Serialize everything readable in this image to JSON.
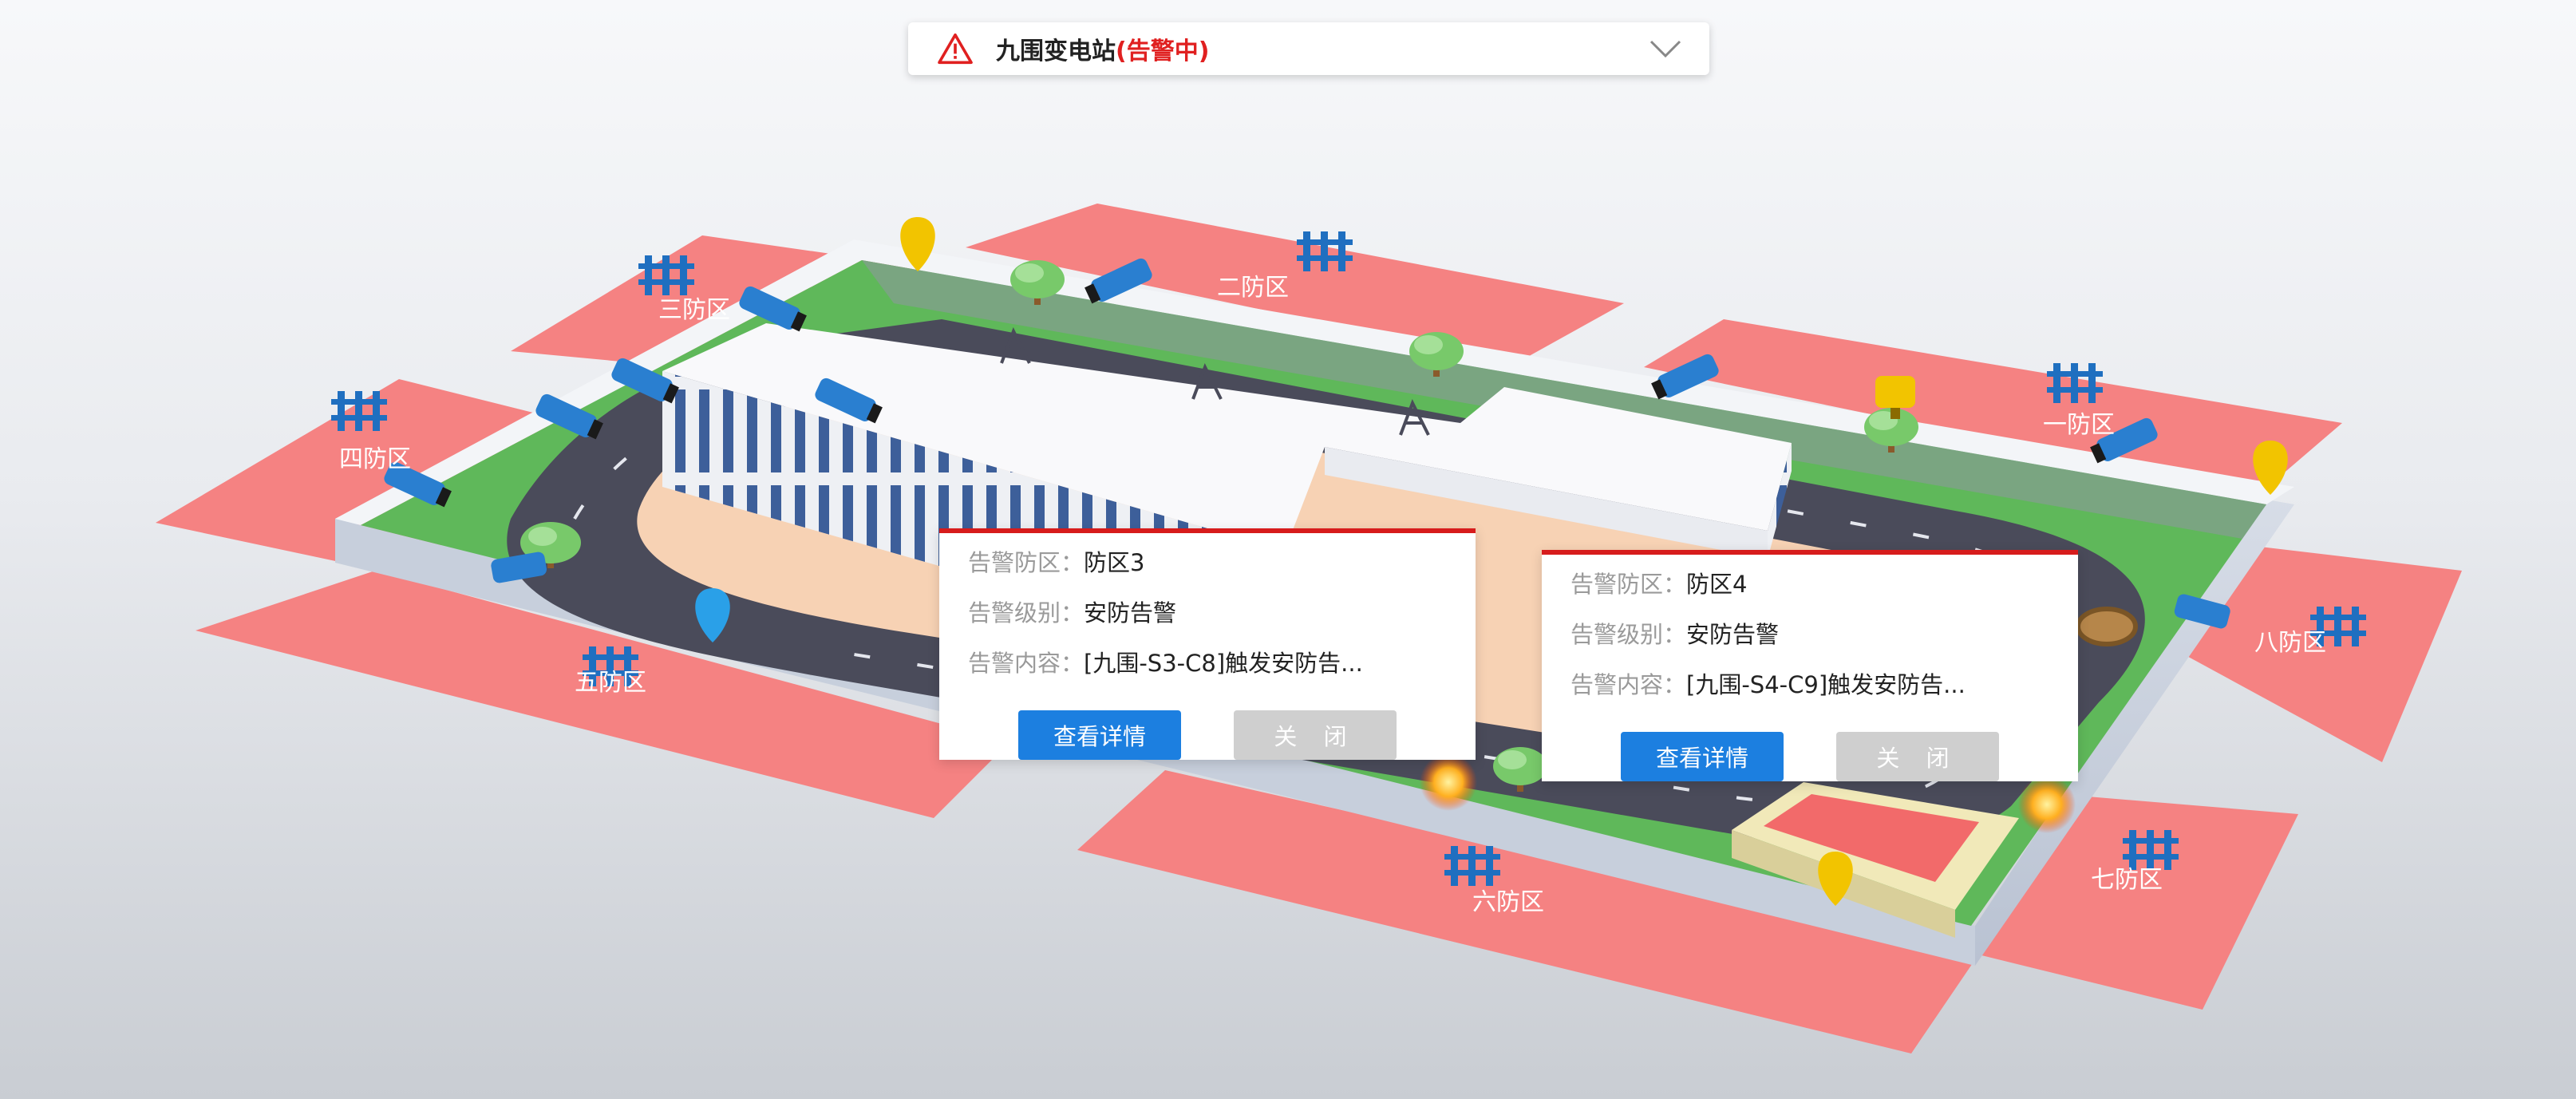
{
  "station": {
    "name": "九围变电站",
    "status": "(告警中)",
    "status_color": "#e02020"
  },
  "zones": [
    {
      "id": "zone-1",
      "label": "一防区"
    },
    {
      "id": "zone-2",
      "label": "二防区"
    },
    {
      "id": "zone-3",
      "label": "三防区"
    },
    {
      "id": "zone-4",
      "label": "四防区"
    },
    {
      "id": "zone-5",
      "label": "五防区"
    },
    {
      "id": "zone-6",
      "label": "六防区"
    },
    {
      "id": "zone-7",
      "label": "七防区"
    },
    {
      "id": "zone-8",
      "label": "八防区"
    }
  ],
  "alerts": [
    {
      "zone_label": "告警防区：",
      "zone_value": "防区3",
      "level_label": "告警级别：",
      "level_value": "安防告警",
      "content_label": "告警内容：",
      "content_value": "[九围-S3-C8]触发安防告...",
      "detail_button": "查看详情",
      "close_button": "关 闭"
    },
    {
      "zone_label": "告警防区：",
      "zone_value": "防区4",
      "level_label": "告警级别：",
      "level_value": "安防告警",
      "content_label": "告警内容：",
      "content_value": "[九围-S4-C9]触发安防告...",
      "detail_button": "查看详情",
      "close_button": "关 闭"
    }
  ],
  "colors": {
    "zone_fill": "#f58282",
    "accent_alert": "#d71c1c",
    "button_primary": "#1c7fe0",
    "button_secondary": "#cfcfcf",
    "grass": "#5fb85a",
    "road": "#4a4b5a",
    "building": "#f4f4f6",
    "camera": "#2a7fd0",
    "fence": "#1f6fc0"
  }
}
